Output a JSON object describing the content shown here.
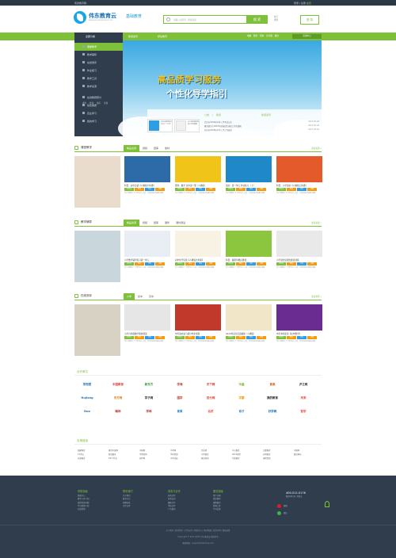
{
  "topbar": {
    "left": "伟德教育网",
    "right_pre": "登录 | 注册",
    "right_accent": "会员"
  },
  "header": {
    "logo_name": "伟东教育云",
    "logo_sub": "WEIDONG EDUCATION CLOUD",
    "logo_tag": "基础教育",
    "search_placeholder": "请输入关键词，搜索资源",
    "search_button": "搜 索",
    "hotlinks": [
      "热门",
      "搜索"
    ],
    "login": "登 录"
  },
  "nav": {
    "category": "全部分类",
    "items": [
      "新闻资讯",
      "师生教育"
    ],
    "right": "电脑 服务 帮助 分享圈 我的",
    "button": "应用中心"
  },
  "sidebar": {
    "items": [
      "课堂教学",
      "教学辅导",
      "在线测评",
      "作业练习",
      "教学工具",
      "教学资源",
      "在线教研研讨",
      "综合素质",
      "自主学习",
      "我的学习"
    ],
    "sub": [
      "课件",
      "微课",
      "题库",
      "专题"
    ],
    "active": 0
  },
  "banner": {
    "line1": "高品质学习服务",
    "line2": "个性化导学指引"
  },
  "news": {
    "cards": [
      {
        "text": "北京市教育委员会关于（公告）"
      },
      {
        "text": "关于提高教育质量工作的通知"
      }
    ],
    "tabs": [
      "公告",
      "新闻"
    ],
    "title": "新闻资讯",
    "lines": [
      {
        "t": "北京市2015年中考入学考试公告",
        "d": "2015-05-26"
      },
      {
        "t": "教育部关于2015年高校招生录取工作的通知",
        "d": "2015-05-26"
      },
      {
        "t": "北京市2015年中学入学工作意见",
        "d": "2015-05-26"
      }
    ]
  },
  "sections": [
    {
      "title": "课堂教学",
      "tabs": [
        "精品资源",
        "视频",
        "题库",
        "素材"
      ],
      "more": "更多资源 »",
      "items": [
        {
          "t": "科目：初中英语【人教版七年级】"
        },
        {
          "t": "理科：数学 高中第一册（人教版）"
        },
        {
          "t": "语文：第一单元 作业练习（上）"
        },
        {
          "t": "科目：小学语文【人教版五年级】"
        }
      ]
    },
    {
      "title": "教学辅导",
      "tabs": [
        "精品资源",
        "视频",
        "题库",
        "课件",
        "课外阅读"
      ],
      "more": "更多资源 »",
      "items": [
        {
          "t": "小学数学辅导练习第一单元"
        },
        {
          "t": "初中化学实验【人教版九年级】"
        },
        {
          "t": "科目：暑期早教实践课"
        },
        {
          "t": "小学语文读课文朗读训练"
        }
      ]
    },
    {
      "title": "在线测评",
      "tabs": [
        "小学",
        "初中",
        "高中"
      ],
      "more": "更多测评 »",
      "items": [
        {
          "t": "小学六年级数学期末测试"
        },
        {
          "t": "中考语文复习满分作文专题"
        },
        {
          "t": "2015年高考英语模拟（人教版）"
        },
        {
          "t": "中考冲刺必读【初中数学】"
        }
      ]
    }
  ],
  "item_badges": [
    "已学习",
    "预习",
    "作业",
    "评测"
  ],
  "item_desc": "已上传课件1个 已学习15 人次，共作业练习及相关讲解",
  "partners": {
    "title": "合作单位",
    "logos": [
      {
        "n": "学而思",
        "c": "#1e6fb7"
      },
      {
        "n": "中国教育",
        "c": "#e03b3b"
      },
      {
        "n": "新东方",
        "c": "#3a9a3a"
      },
      {
        "n": "学海",
        "c": "#c0392b"
      },
      {
        "n": "天下网",
        "c": "#e23e2e"
      },
      {
        "n": "华鑫",
        "c": "#7fc03a"
      },
      {
        "n": "育英",
        "c": "#d35400"
      },
      {
        "n": "沪江网",
        "c": "#333333"
      },
      {
        "n": "Hujiang",
        "c": "#1e6fb7"
      },
      {
        "n": "东方网",
        "c": "#e67e22"
      },
      {
        "n": "学子网",
        "c": "#333333"
      },
      {
        "n": "国学",
        "c": "#c0392b"
      },
      {
        "n": "百分网",
        "c": "#e74c3c"
      },
      {
        "n": "学霸",
        "c": "#f39c12"
      },
      {
        "n": "我的教育",
        "c": "#222222"
      },
      {
        "n": "未来",
        "c": "#e74c3c"
      },
      {
        "n": "Duo",
        "c": "#1e6fb7"
      },
      {
        "n": "翰林",
        "c": "#c0392b"
      },
      {
        "n": "学林",
        "c": "#b03030"
      },
      {
        "n": "青果",
        "c": "#2e86c1"
      },
      {
        "n": "名校",
        "c": "#e84c3d"
      },
      {
        "n": "育才",
        "c": "#2e86c1"
      },
      {
        "n": "好学网",
        "c": "#1e6fb7"
      },
      {
        "n": "智学",
        "c": "#e74c3c"
      }
    ]
  },
  "links": {
    "title": "友情链接",
    "cols": [
      [
        "国家教育",
        "21世纪",
        "乐课教育"
      ],
      [
        "教育中国网",
        "新浪教育",
        "2017作业"
      ],
      [
        "中国网",
        "学而思网",
        "国学网"
      ],
      [
        "中考网",
        "学科资源",
        "中考试卷"
      ],
      [
        "作业帮",
        "中考教育",
        "教育新闻"
      ],
      [
        "中公教育",
        "2016课堂",
        "华英教育"
      ],
      [
        "文都教育",
        "启明教育",
        "课程资源"
      ],
      [
        "中国网",
        "教育网站",
        ""
      ]
    ]
  },
  "footer": {
    "cols": [
      {
        "h": "帮助指南",
        "l": [
          "帮助中心",
          "教学工具介绍",
          "使用常见问题",
          "学习资源介绍",
          "在线资源"
        ]
      },
      {
        "h": "联系我们",
        "l": [
          "关于我们",
          "联系方式",
          "招聘信息",
          "合作伙伴"
        ]
      },
      {
        "h": "商务与合作",
        "l": [
          "商务合作",
          "技术支持",
          "媒体合作",
          "学校合作",
          "广告服务"
        ]
      },
      {
        "h": "服务指南",
        "l": [
          "用户注册",
          "找回密码",
          "课程服务",
          "资源上传",
          "学习反馈"
        ]
      }
    ],
    "phone": "400-012-0176",
    "phone_note": "服务时间 周一至周五",
    "social": [
      "微博",
      "微信"
    ],
    "copy1": "关于我们 | 联系我们 | 合作伙伴 | 帮助中心 | 网站地图 | 免责声明 | 隐私政策",
    "copy2": "Copyright © 2011-2015 伟东教育云 版权所有",
    "copy3": "客服邮箱：support@weidong.com"
  }
}
